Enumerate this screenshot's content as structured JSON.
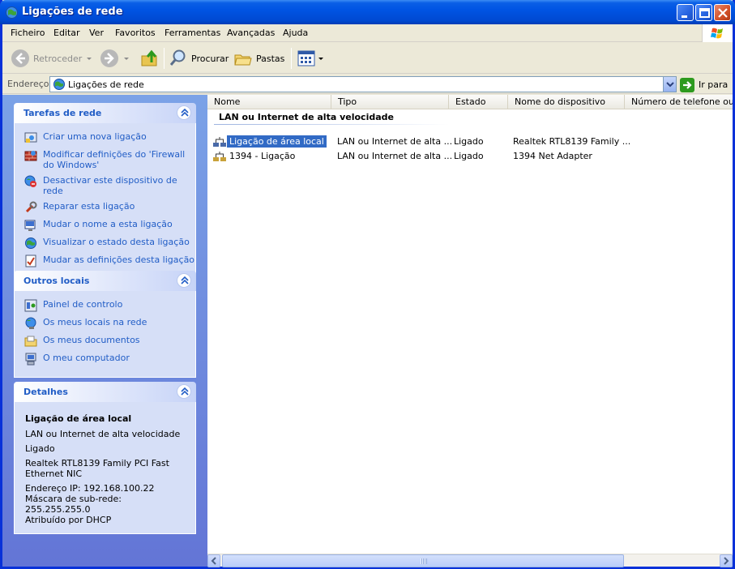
{
  "window": {
    "title": "Ligações de rede"
  },
  "menu": [
    "Ficheiro",
    "Editar",
    "Ver",
    "Favoritos",
    "Ferramentas",
    "Avançadas",
    "Ajuda"
  ],
  "toolbar": {
    "back_label": "Retroceder",
    "search_label": "Procurar",
    "folders_label": "Pastas"
  },
  "address": {
    "label": "Endereço",
    "value": "Ligações de rede",
    "go_label": "Ir para"
  },
  "tasks_panel": {
    "title": "Tarefas de rede",
    "items": [
      {
        "label": "Criar uma nova ligação",
        "icon": "new-connection-icon"
      },
      {
        "label": "Modificar definições do 'Firewall do Windows'",
        "icon": "firewall-icon"
      },
      {
        "label": "Desactivar este dispositivo de rede",
        "icon": "disable-network-icon"
      },
      {
        "label": "Reparar esta ligação",
        "icon": "repair-icon"
      },
      {
        "label": "Mudar o nome a esta ligação",
        "icon": "rename-icon"
      },
      {
        "label": "Visualizar o estado desta ligação",
        "icon": "status-icon"
      },
      {
        "label": "Mudar as definições desta ligação",
        "icon": "settings-icon"
      }
    ]
  },
  "places_panel": {
    "title": "Outros locais",
    "items": [
      {
        "label": "Painel de controlo",
        "icon": "control-panel-icon"
      },
      {
        "label": "Os meus locais na rede",
        "icon": "network-places-icon"
      },
      {
        "label": "Os meus documentos",
        "icon": "my-documents-icon"
      },
      {
        "label": "O meu computador",
        "icon": "my-computer-icon"
      }
    ]
  },
  "details_panel": {
    "title": "Detalhes",
    "name": "Ligação de área local",
    "type": "LAN ou Internet de alta velocidade",
    "status": "Ligado",
    "device_line1": "Realtek RTL8139 Family PCI Fast",
    "device_line2": "Ethernet NIC",
    "ip": "Endereço IP: 192.168.100.22",
    "mask": "Máscara de sub-rede: 255.255.255.0",
    "dhcp": "Atribuído por DHCP"
  },
  "columns": [
    "Nome",
    "Tipo",
    "Estado",
    "Nome do dispositivo",
    "Número de telefone ou ..."
  ],
  "group_title": "LAN ou Internet de alta velocidade",
  "rows": [
    {
      "name": "Ligação de área local",
      "type": "LAN ou Internet de alta ...",
      "status": "Ligado",
      "device": "Realtek RTL8139 Family ...",
      "selected": true
    },
    {
      "name": "1394 - Ligação",
      "type": "LAN ou Internet de alta ...",
      "status": "Ligado",
      "device": "1394 Net Adapter",
      "selected": false
    }
  ],
  "colors": {
    "title_blue": "#0054e3",
    "link_blue": "#215dc6",
    "selection": "#316ac5"
  }
}
